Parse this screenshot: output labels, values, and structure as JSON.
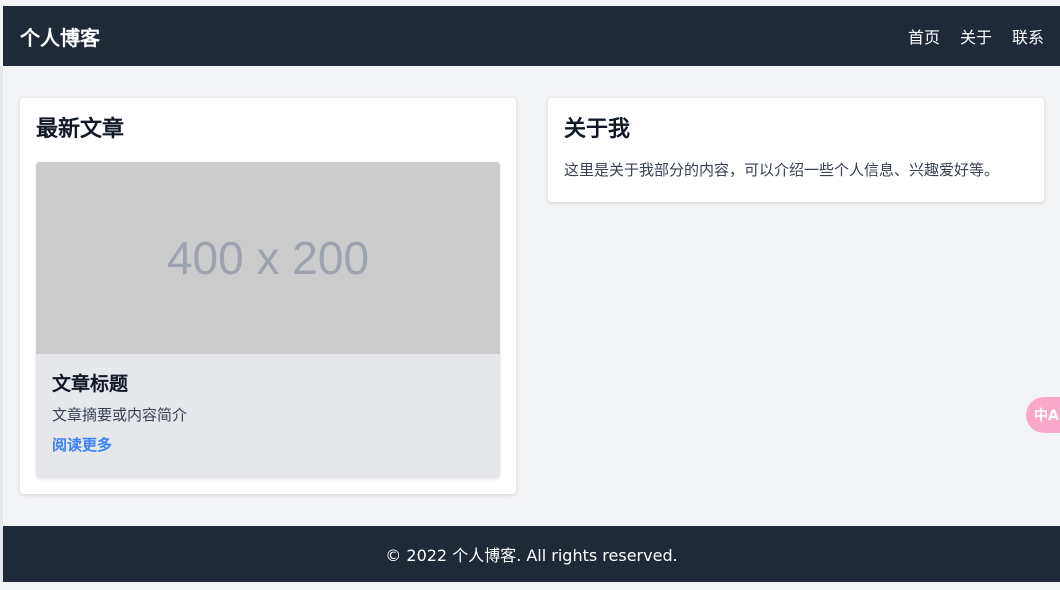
{
  "header": {
    "brand": "个人博客",
    "nav": [
      {
        "label": "首页"
      },
      {
        "label": "关于"
      },
      {
        "label": "联系"
      }
    ]
  },
  "latest": {
    "title": "最新文章",
    "article": {
      "thumbnail_text": "400 x 200",
      "title": "文章标题",
      "summary": "文章摘要或内容简介",
      "read_more": "阅读更多"
    }
  },
  "about": {
    "title": "关于我",
    "text": "这里是关于我部分的内容，可以介绍一些个人信息、兴趣爱好等。"
  },
  "footer": {
    "text": "© 2022 个人博客. All rights reserved."
  },
  "floating": {
    "translate_icon": "translate-icon",
    "translate_glyph": "中A"
  },
  "colors": {
    "header_bg": "#1f2937",
    "page_bg": "#f3f4f6",
    "link": "#3b82f6",
    "thumb_bg": "#cccccc",
    "translate_bg": "#f9a8c9"
  }
}
